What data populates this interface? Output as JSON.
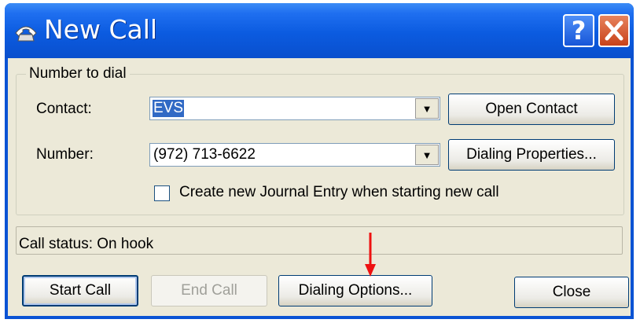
{
  "window": {
    "title": "New Call",
    "title_icon": "telephone-icon",
    "help_glyph": "?",
    "close_icon": "close-x-icon"
  },
  "group": {
    "legend": "Number to dial",
    "contact_label": "Contact:",
    "contact_value": "EVS",
    "number_label": "Number:",
    "number_value": "(972) 713-6622",
    "open_contact_label": "Open Contact",
    "dialing_properties_label": "Dialing Properties...",
    "journal_checkbox_label": "Create new Journal Entry when starting new call",
    "journal_checked": false
  },
  "status": {
    "text": "Call status:  On hook"
  },
  "buttons": {
    "start_call": "Start Call",
    "end_call": "End Call",
    "dialing_options": "Dialing Options...",
    "close": "Close"
  },
  "colors": {
    "title_bar": "#0b5be0",
    "dialog_bg": "#ece9d8",
    "selection": "#316ac5",
    "annotation_arrow": "#ee1111"
  }
}
